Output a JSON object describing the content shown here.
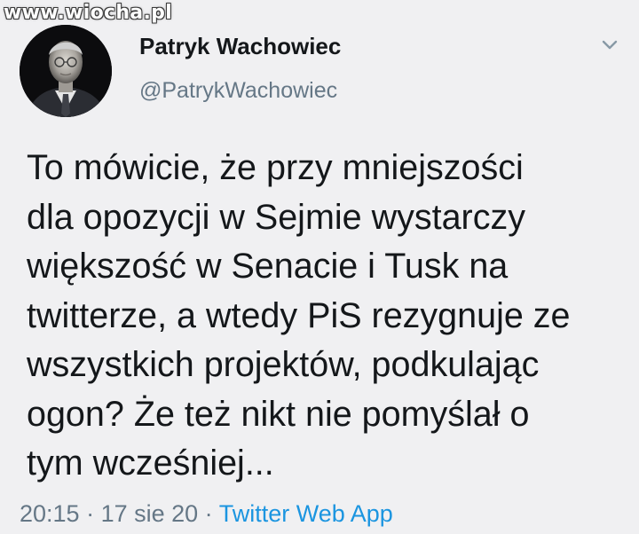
{
  "watermark": "www.wiocha.pl",
  "tweet": {
    "author": {
      "display_name": "Patryk Wachowiec",
      "handle": "@PatrykWachowiec"
    },
    "text": "To mówicie, że przy mniejszości\ndla opozycji w Sejmie wystarczy\nwiększość w Senacie i Tusk na\ntwitterze, a wtedy PiS rezygnuje ze\nwszystkich projektów, podkulając\nogon? Że też nikt nie pomyślał o\ntym wcześniej...",
    "time": "20:15",
    "separator": " · ",
    "date": "17 sie 20",
    "source": "Twitter Web App"
  },
  "icons": {
    "menu": "chevron-down-icon"
  },
  "colors": {
    "background": "#f0f0f2",
    "text": "#14171a",
    "muted": "#657786",
    "link": "#1b95e0"
  }
}
